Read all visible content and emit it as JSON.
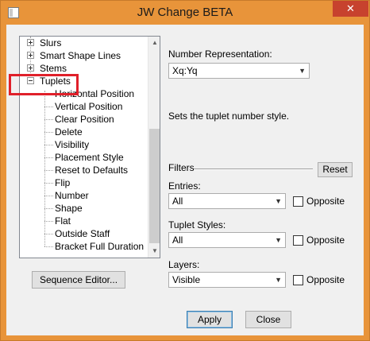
{
  "window": {
    "title": "JW Change BETA",
    "close_glyph": "✕"
  },
  "tree": {
    "items": [
      {
        "label": "Slurs",
        "state": "collapsed"
      },
      {
        "label": "Smart Shape Lines",
        "state": "collapsed"
      },
      {
        "label": "Stems",
        "state": "collapsed"
      },
      {
        "label": "Tuplets",
        "state": "expanded"
      },
      {
        "label": "Horizontal Position"
      },
      {
        "label": "Vertical Position"
      },
      {
        "label": "Clear Position"
      },
      {
        "label": "Delete"
      },
      {
        "label": "Visibility"
      },
      {
        "label": "Placement Style"
      },
      {
        "label": "Reset to Defaults"
      },
      {
        "label": "Flip"
      },
      {
        "label": "Number"
      },
      {
        "label": "Shape"
      },
      {
        "label": "Flat"
      },
      {
        "label": "Outside Staff"
      },
      {
        "label": "Bracket Full Duration"
      }
    ],
    "highlight_color": "#e0202a"
  },
  "buttons": {
    "sequence_editor": "Sequence Editor...",
    "reset": "Reset",
    "apply": "Apply",
    "close": "Close"
  },
  "settings": {
    "number_rep_label": "Number Representation:",
    "number_rep_value": "Xq:Yq",
    "description": "Sets the tuplet number style.",
    "filters_label": "Filters",
    "entries_label": "Entries:",
    "entries_value": "All",
    "tuplet_styles_label": "Tuplet Styles:",
    "tuplet_styles_value": "All",
    "layers_label": "Layers:",
    "layers_value": "Visible",
    "opposite_label": "Opposite"
  },
  "colors": {
    "titlebar": "#e8943a",
    "close": "#c7422e"
  }
}
